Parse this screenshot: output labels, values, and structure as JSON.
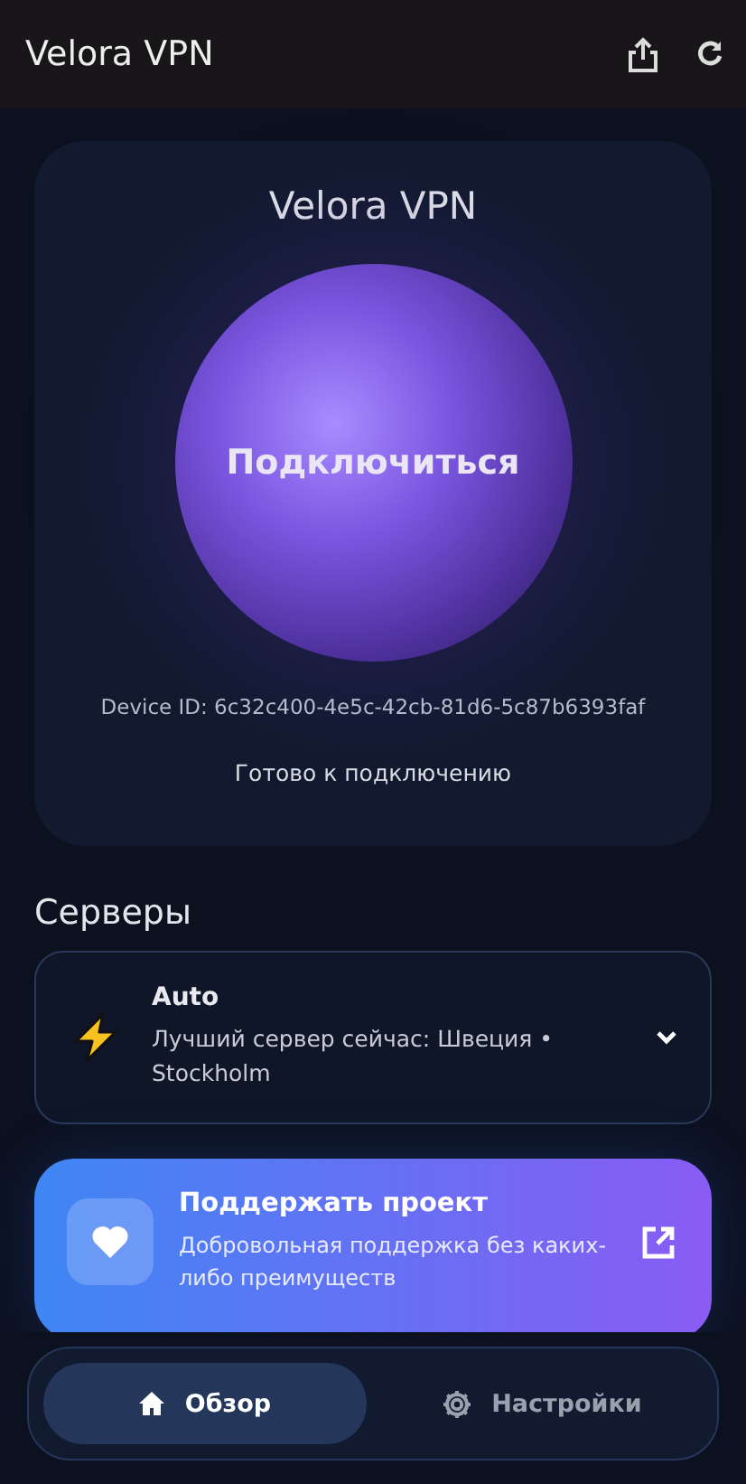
{
  "app_bar": {
    "title": "Velora VPN"
  },
  "connect_card": {
    "title": "Velora VPN",
    "button": "Подключиться",
    "device_id": "Device ID: 6c32c400-4e5c-42cb-81d6-5c87b6393faf",
    "status": "Готово к подключению"
  },
  "servers": {
    "heading": "Серверы",
    "selected": {
      "name": "Auto",
      "description": "Лучший сервер сейчас: Швеция • Stockholm"
    }
  },
  "support": {
    "title": "Поддержать проект",
    "description": "Добровольная поддержка без каких-либо преимуществ"
  },
  "nav": [
    {
      "label": "Обзор",
      "kind": "home",
      "selected": true
    },
    {
      "label": "Настройки",
      "kind": "settings",
      "selected": false
    }
  ]
}
